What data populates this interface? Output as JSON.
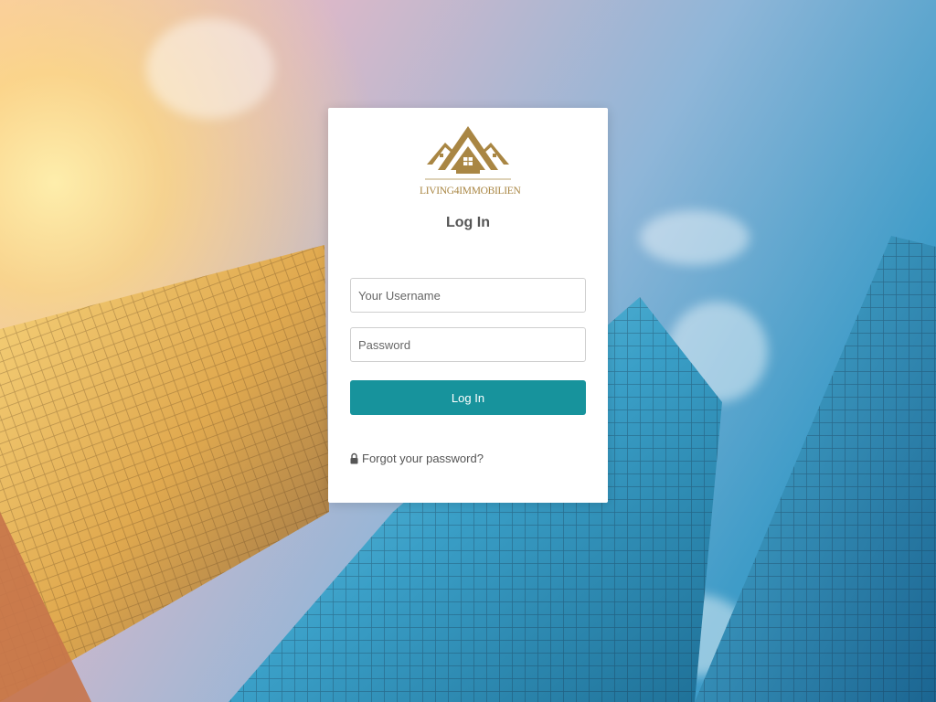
{
  "brand": {
    "logo_text": "LIVING4IMMOBILIEN",
    "logo_color": "#a98643"
  },
  "login": {
    "title": "Log In",
    "username_placeholder": "Your Username",
    "password_placeholder": "Password",
    "submit_label": "Log In",
    "forgot_label": "Forgot your password?",
    "forgot_icon": "lock-icon"
  },
  "colors": {
    "accent": "#17939c",
    "card_background": "#ffffff",
    "text": "#555555"
  }
}
